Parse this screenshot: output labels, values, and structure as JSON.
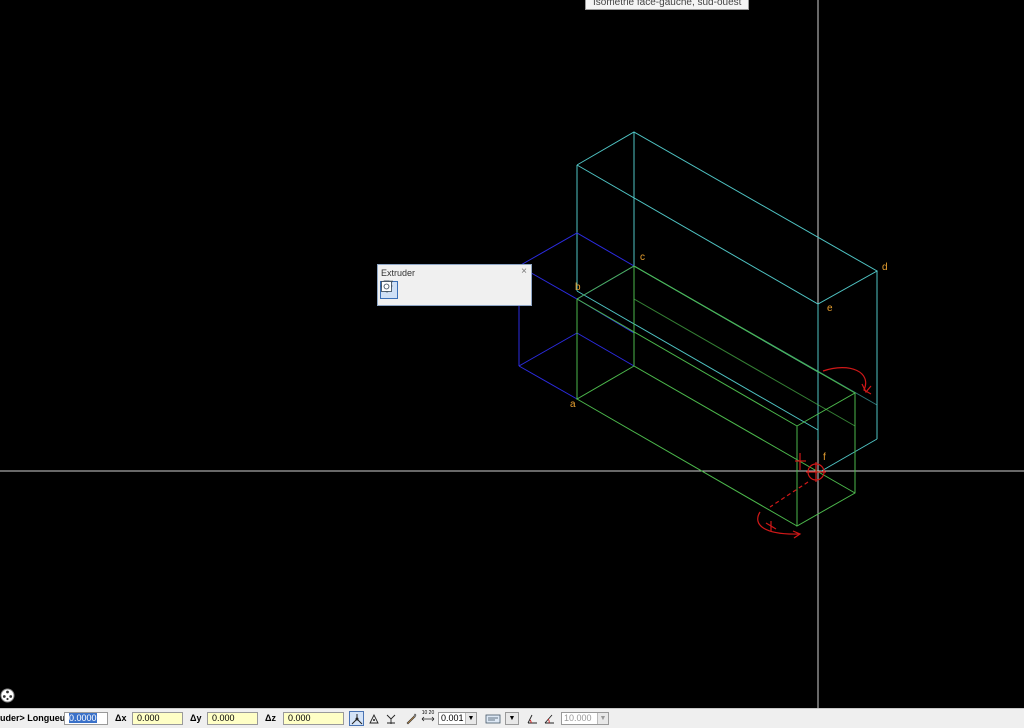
{
  "view_tooltip": "Isométrie face-gauche, sud-ouest",
  "points": {
    "a": "a",
    "b": "b",
    "c": "c",
    "d": "d",
    "e": "e",
    "f": "f"
  },
  "colors": {
    "background": "#000000",
    "cyan_box": "#4fc3c3",
    "blue_box": "#2b2be0",
    "green_box": "#4cb84c",
    "annotation": "#d01818",
    "point_label": "#e8a030",
    "crosshair": "#c8c8c8"
  },
  "extruder_toolbar": {
    "title": "Extruder",
    "close": "×",
    "tools": [
      "extrude-tool",
      "taper-tool",
      "shell-tool",
      "revolve-tool",
      "box-tool",
      "sphere-tool",
      "polygon-prism-tool",
      "options-tool"
    ],
    "active_tool": "extrude-tool"
  },
  "statusbar": {
    "prompt": "uder> Longueur",
    "length_value": "0.0000",
    "dx_label": "Δx",
    "dx_value": "0.000",
    "dy_label": "Δy",
    "dy_value": "0.000",
    "dz_label": "Δz",
    "dz_value": "0.000",
    "ratio_label": "10 20",
    "precision_value": "0.001",
    "angle_value": "10.000"
  }
}
